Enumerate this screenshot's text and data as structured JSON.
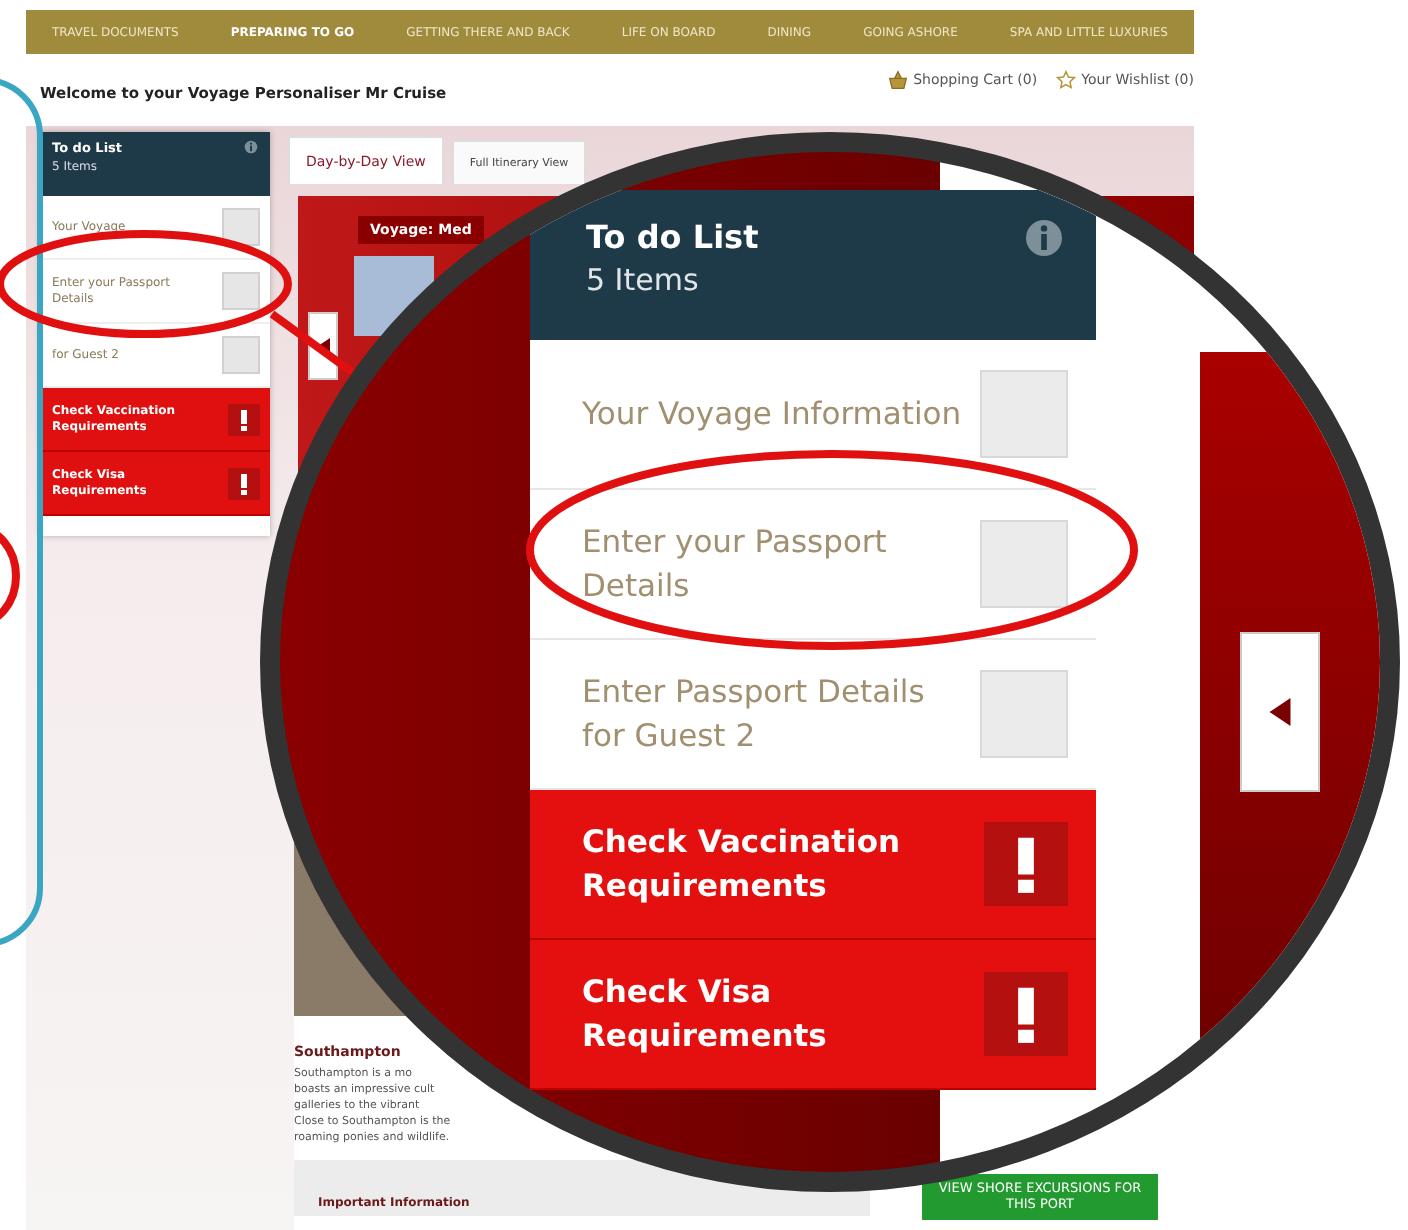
{
  "nav": {
    "items": [
      {
        "label": "TRAVEL DOCUMENTS",
        "selected": false
      },
      {
        "label": "PREPARING TO GO",
        "selected": true
      },
      {
        "label": "GETTING THERE AND BACK",
        "selected": false
      },
      {
        "label": "LIFE ON BOARD",
        "selected": false
      },
      {
        "label": "DINING",
        "selected": false
      },
      {
        "label": "GOING ASHORE",
        "selected": false
      },
      {
        "label": "SPA AND LITTLE LUXURIES",
        "selected": false
      }
    ]
  },
  "header": {
    "welcome": "Welcome to your Voyage Personaliser Mr Cruise",
    "cart": "Shopping Cart (0)",
    "wishlist": "Your Wishlist (0)"
  },
  "todo": {
    "title": "To do List",
    "count": "5 Items",
    "items": [
      {
        "kind": "checkbox",
        "text": "Your Voyage",
        "checked": false
      },
      {
        "kind": "checkbox",
        "text": "Enter your Passport Details",
        "checked": false
      },
      {
        "kind": "checkbox",
        "text": "for Guest 2",
        "checked": false
      },
      {
        "kind": "alert",
        "text": "Check Vaccination Requirements"
      },
      {
        "kind": "alert",
        "text": "Check Visa Requirements"
      }
    ]
  },
  "tabs": [
    {
      "label": "Day-by-Day View",
      "selected": true
    },
    {
      "label": "Full Itinerary View",
      "selected": false
    }
  ],
  "voyage": {
    "label": "Voyage: Med"
  },
  "port": {
    "name": "Southampton",
    "description_lines": [
      "Southampton is a mo",
      "boasts an impressive cult",
      "galleries to the vibrant",
      "Close to Southampton is the",
      "roaming ponies and wildlife."
    ],
    "info_title": "Important Information",
    "excursions_button": "VIEW SHORE EXCURSIONS FOR THIS PORT"
  },
  "magnifier": {
    "todo": {
      "title": "To do List",
      "count": "5 Items",
      "items": [
        {
          "kind": "checkbox",
          "text": "Your Voyage Information",
          "checked": false
        },
        {
          "kind": "checkbox",
          "text": "Enter your Passport Details",
          "checked": false
        },
        {
          "kind": "checkbox",
          "text": "Enter Passport Details for Guest 2",
          "checked": false
        },
        {
          "kind": "alert",
          "text": "Check Vaccination Requirements"
        },
        {
          "kind": "alert",
          "text": "Check Visa Requirements"
        }
      ]
    }
  }
}
